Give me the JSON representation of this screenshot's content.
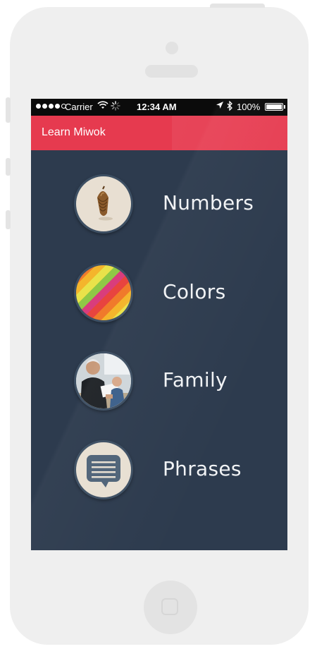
{
  "status_bar": {
    "carrier": "Carrier",
    "time": "12:34 AM",
    "battery": "100%",
    "icons": [
      "signal-dots",
      "wifi-icon",
      "activity-spinner-icon",
      "location-arrow-icon",
      "bluetooth-icon",
      "battery-icon"
    ]
  },
  "app_bar": {
    "title": "Learn Miwok",
    "color": "#e63a4f"
  },
  "theme": {
    "background": "#2d3b4e",
    "circle_fill": "#e8dfd2",
    "circle_border": "#3d4f63"
  },
  "categories": [
    {
      "label": "Numbers",
      "icon": "acorn-icon"
    },
    {
      "label": "Colors",
      "icon": "rainbow-stripes-icon"
    },
    {
      "label": "Family",
      "icon": "family-photo-icon"
    },
    {
      "label": "Phrases",
      "icon": "speech-bubble-icon"
    }
  ]
}
